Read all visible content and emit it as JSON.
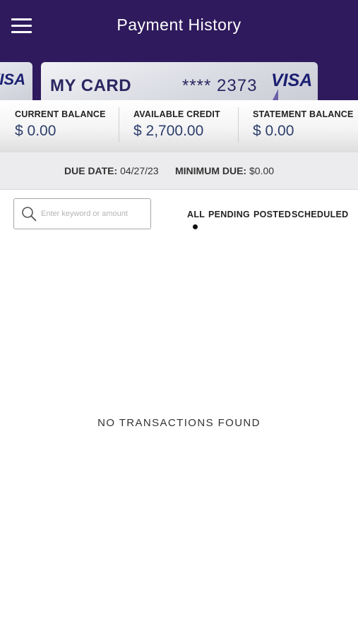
{
  "header": {
    "title": "Payment History",
    "background": "#2e1a5c"
  },
  "cards": {
    "peek_logo": "VISA",
    "current": {
      "name": "MY CARD",
      "number_masked": "**** 2373",
      "brand": "VISA"
    }
  },
  "balances": [
    {
      "label": "CURRENT BALANCE",
      "value": "$ 0.00"
    },
    {
      "label": "AVAILABLE CREDIT",
      "value": "$ 2,700.00"
    },
    {
      "label": "STATEMENT BALANCE",
      "value": "$ 0.00"
    }
  ],
  "due": {
    "due_date_label": "DUE DATE:",
    "due_date_value": "04/27/23",
    "minimum_due_label": "MINIMUM DUE:",
    "minimum_due_value": "$0.00"
  },
  "search": {
    "placeholder": "Enter keyword or amount",
    "value": ""
  },
  "filters": {
    "tabs": [
      "ALL",
      "PENDING",
      "POSTED",
      "SCHEDULED"
    ],
    "selected": "ALL"
  },
  "empty_state": "NO TRANSACTIONS FOUND",
  "icons": {
    "menu": "hamburger-menu-icon",
    "search": "search-icon"
  }
}
